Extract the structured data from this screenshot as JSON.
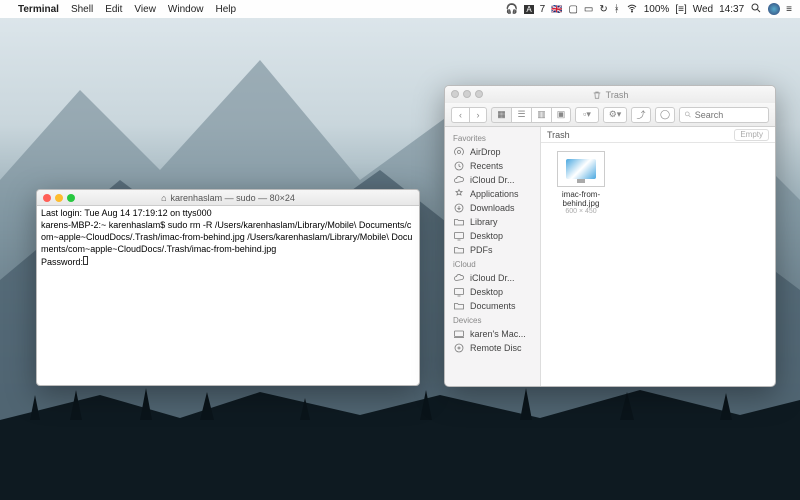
{
  "menubar": {
    "app": "Terminal",
    "items": [
      "Shell",
      "Edit",
      "View",
      "Window",
      "Help"
    ],
    "status": {
      "battery": "100%",
      "battery_icon": "[≡]",
      "day": "Wed",
      "time": "14:37"
    },
    "adobe": "7"
  },
  "terminal": {
    "title": "karenhaslam — sudo — 80×24",
    "icon": "⌂",
    "lines": [
      "Last login: Tue Aug 14 17:19:12 on ttys000",
      "karens-MBP-2:~ karenhaslam$ sudo rm -R /Users/karenhaslam/Library/Mobile\\ Documents/com~apple~CloudDocs/.Trash/imac-from-behind.jpg /Users/karenhaslam/Library/Mobile\\ Documents/com~apple~CloudDocs/.Trash/imac-from-behind.jpg",
      "Password:"
    ]
  },
  "finder": {
    "title": "Trash",
    "search_placeholder": "Search",
    "pathbar": {
      "label": "Trash",
      "button": "Empty"
    },
    "sidebar": {
      "sections": [
        {
          "label": "Favorites",
          "items": [
            {
              "icon": "airdrop",
              "label": "AirDrop"
            },
            {
              "icon": "recents",
              "label": "Recents"
            },
            {
              "icon": "cloud",
              "label": "iCloud Dr..."
            },
            {
              "icon": "apps",
              "label": "Applications"
            },
            {
              "icon": "downloads",
              "label": "Downloads"
            },
            {
              "icon": "folder",
              "label": "Library"
            },
            {
              "icon": "desktop",
              "label": "Desktop"
            },
            {
              "icon": "folder",
              "label": "PDFs"
            }
          ]
        },
        {
          "label": "iCloud",
          "items": [
            {
              "icon": "cloud",
              "label": "iCloud Dr..."
            },
            {
              "icon": "desktop",
              "label": "Desktop"
            },
            {
              "icon": "folder",
              "label": "Documents"
            }
          ]
        },
        {
          "label": "Devices",
          "items": [
            {
              "icon": "mac",
              "label": "karen's Mac..."
            },
            {
              "icon": "disc",
              "label": "Remote Disc"
            }
          ]
        }
      ]
    },
    "files": [
      {
        "name": "imac-from-behind.jpg",
        "dims": "600 × 450"
      }
    ]
  }
}
